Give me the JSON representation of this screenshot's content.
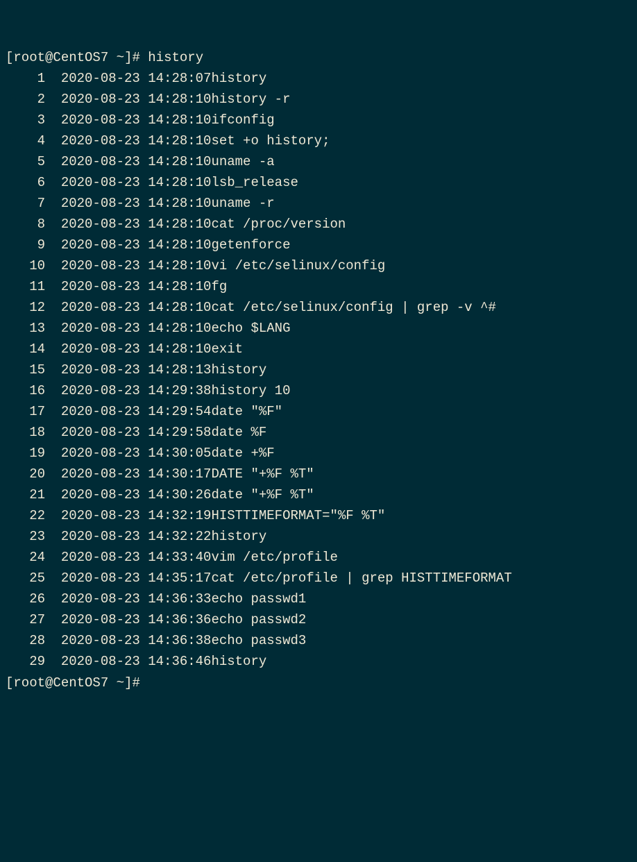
{
  "prompt": {
    "bracket_open": "[",
    "user": "root",
    "at": "@",
    "host": "CentOS7",
    "space": " ",
    "path": "~",
    "bracket_close": "]",
    "hash": "#",
    "command": "history"
  },
  "history": [
    {
      "n": "    1",
      "ts": "2020-08-23 14:28:07",
      "cmd": "history"
    },
    {
      "n": "    2",
      "ts": "2020-08-23 14:28:10",
      "cmd": "history -r"
    },
    {
      "n": "    3",
      "ts": "2020-08-23 14:28:10",
      "cmd": "ifconfig"
    },
    {
      "n": "    4",
      "ts": "2020-08-23 14:28:10",
      "cmd": "set +o history;"
    },
    {
      "n": "    5",
      "ts": "2020-08-23 14:28:10",
      "cmd": "uname -a"
    },
    {
      "n": "    6",
      "ts": "2020-08-23 14:28:10",
      "cmd": "lsb_release"
    },
    {
      "n": "    7",
      "ts": "2020-08-23 14:28:10",
      "cmd": "uname -r"
    },
    {
      "n": "    8",
      "ts": "2020-08-23 14:28:10",
      "cmd": "cat /proc/version"
    },
    {
      "n": "    9",
      "ts": "2020-08-23 14:28:10",
      "cmd": "getenforce"
    },
    {
      "n": "   10",
      "ts": "2020-08-23 14:28:10",
      "cmd": "vi /etc/selinux/config"
    },
    {
      "n": "   11",
      "ts": "2020-08-23 14:28:10",
      "cmd": "fg"
    },
    {
      "n": "   12",
      "ts": "2020-08-23 14:28:10",
      "cmd": "cat /etc/selinux/config | grep -v ^#"
    },
    {
      "n": "   13",
      "ts": "2020-08-23 14:28:10",
      "cmd": "echo $LANG"
    },
    {
      "n": "   14",
      "ts": "2020-08-23 14:28:10",
      "cmd": "exit"
    },
    {
      "n": "   15",
      "ts": "2020-08-23 14:28:13",
      "cmd": "history"
    },
    {
      "n": "   16",
      "ts": "2020-08-23 14:29:38",
      "cmd": "history 10"
    },
    {
      "n": "   17",
      "ts": "2020-08-23 14:29:54",
      "cmd": "date \"%F\""
    },
    {
      "n": "   18",
      "ts": "2020-08-23 14:29:58",
      "cmd": "date %F"
    },
    {
      "n": "   19",
      "ts": "2020-08-23 14:30:05",
      "cmd": "date +%F"
    },
    {
      "n": "   20",
      "ts": "2020-08-23 14:30:17",
      "cmd": "DATE \"+%F %T\""
    },
    {
      "n": "   21",
      "ts": "2020-08-23 14:30:26",
      "cmd": "date \"+%F %T\""
    },
    {
      "n": "   22",
      "ts": "2020-08-23 14:32:19",
      "cmd": "HISTTIMEFORMAT=\"%F %T\""
    },
    {
      "n": "   23",
      "ts": "2020-08-23 14:32:22",
      "cmd": "history"
    },
    {
      "n": "   24",
      "ts": "2020-08-23 14:33:40",
      "cmd": "vim /etc/profile"
    },
    {
      "n": "   25",
      "ts": "2020-08-23 14:35:17",
      "cmd": "cat /etc/profile | grep HISTTIMEFORMAT"
    },
    {
      "n": "   26",
      "ts": "2020-08-23 14:36:33",
      "cmd": "echo passwd1"
    },
    {
      "n": "   27",
      "ts": "2020-08-23 14:36:36",
      "cmd": "echo passwd2"
    },
    {
      "n": "   28",
      "ts": "2020-08-23 14:36:38",
      "cmd": "echo passwd3"
    },
    {
      "n": "   29",
      "ts": "2020-08-23 14:36:46",
      "cmd": "history"
    }
  ]
}
